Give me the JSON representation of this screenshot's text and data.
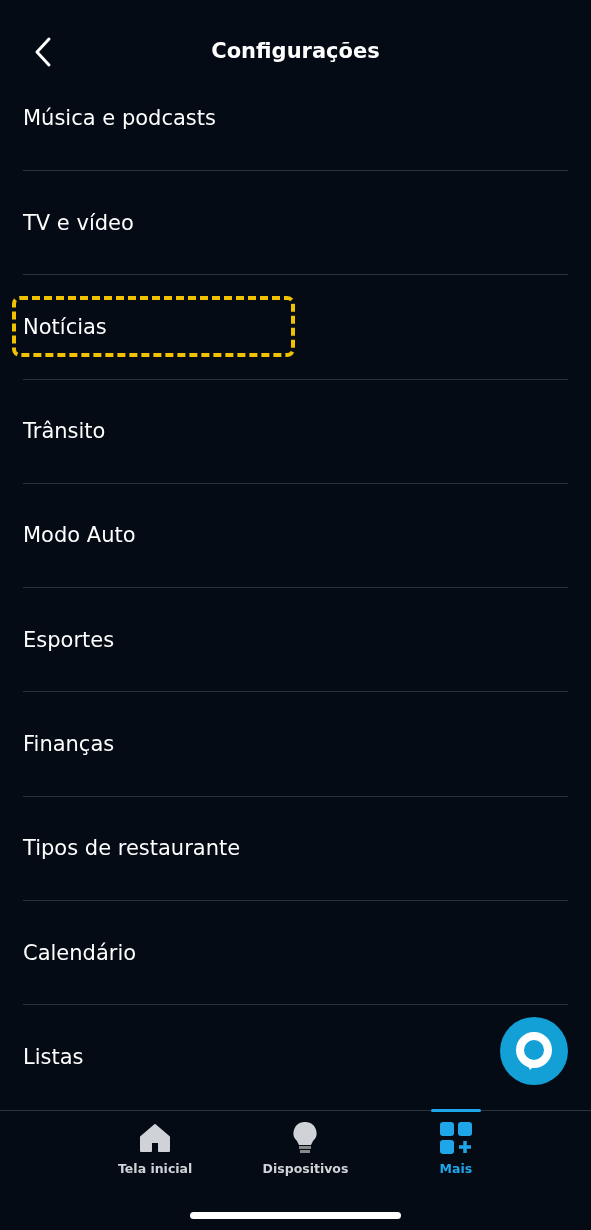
{
  "header": {
    "title": "Configurações"
  },
  "items": [
    {
      "label": "Música e podcasts",
      "highlighted": false
    },
    {
      "label": "TV e vídeo",
      "highlighted": false
    },
    {
      "label": "Notícias",
      "highlighted": true
    },
    {
      "label": "Trânsito",
      "highlighted": false
    },
    {
      "label": "Modo Auto",
      "highlighted": false
    },
    {
      "label": "Esportes",
      "highlighted": false
    },
    {
      "label": "Finanças",
      "highlighted": false
    },
    {
      "label": "Tipos de restaurante",
      "highlighted": false
    },
    {
      "label": "Calendário",
      "highlighted": false
    },
    {
      "label": "Listas",
      "highlighted": false
    }
  ],
  "nav": [
    {
      "kind": "home",
      "label": "Tela inicial",
      "selected": false
    },
    {
      "kind": "devices",
      "label": "Dispositivos",
      "selected": false
    },
    {
      "kind": "more",
      "label": "Mais",
      "selected": true
    }
  ]
}
